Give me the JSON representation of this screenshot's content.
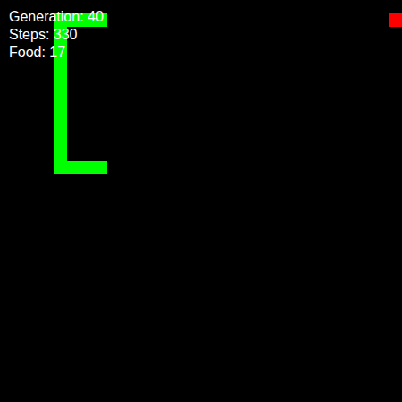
{
  "hud": {
    "generation": "Generation: 40",
    "steps": "Steps: 330",
    "food": "Food: 17"
  },
  "grid": {
    "cols": 30,
    "rows": 30
  },
  "snake": [
    [
      7,
      1
    ],
    [
      6,
      1
    ],
    [
      5,
      1
    ],
    [
      4,
      1
    ],
    [
      4,
      2
    ],
    [
      4,
      3
    ],
    [
      4,
      4
    ],
    [
      4,
      5
    ],
    [
      4,
      6
    ],
    [
      4,
      7
    ],
    [
      4,
      8
    ],
    [
      4,
      9
    ],
    [
      4,
      10
    ],
    [
      4,
      11
    ],
    [
      4,
      12
    ],
    [
      5,
      12
    ],
    [
      6,
      12
    ],
    [
      7,
      12
    ]
  ],
  "food": [
    29,
    1
  ],
  "colors": {
    "snake": "#00ff00",
    "food": "#ff0000"
  }
}
